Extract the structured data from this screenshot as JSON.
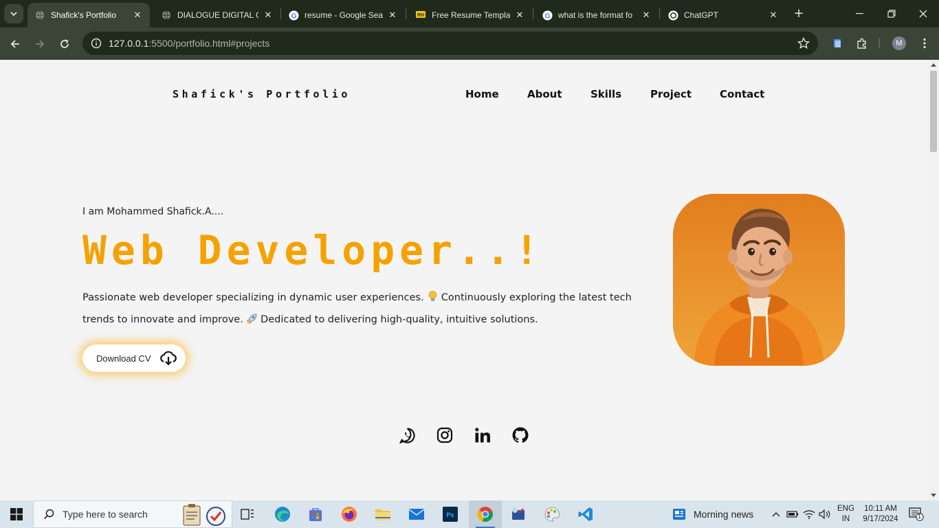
{
  "browser": {
    "tabs": [
      {
        "title": "Shafick's Portfolio",
        "active": true,
        "icon": "globe-icon"
      },
      {
        "title": "DIALOGUE DIGITAL G",
        "active": false,
        "icon": "globe-icon"
      },
      {
        "title": "resume - Google Sear",
        "active": false,
        "icon": "google-icon"
      },
      {
        "title": "Free Resume Templat",
        "active": false,
        "icon": "resume-site-icon"
      },
      {
        "title": "what is the format fo",
        "active": false,
        "icon": "google-icon"
      },
      {
        "title": "ChatGPT",
        "active": false,
        "icon": "chatgpt-icon"
      }
    ],
    "url_host": "127.0.0.1",
    "url_path": ":5500/portfolio.html#projects",
    "profile_initial": "M"
  },
  "site": {
    "logo": "Shafick's Portfolio",
    "nav": [
      "Home",
      "About",
      "Skills",
      "Project",
      "Contact"
    ],
    "intro": "I am Mohammed Shafick.A....",
    "headline": "Web Developer..!",
    "desc_part1": "Passionate web developer specializing in dynamic user experiences.",
    "desc_part2": "Continuously exploring the latest tech trends to innovate and improve.",
    "desc_part3": "Dedicated to delivering high-quality, intuitive solutions.",
    "cv_label": "Download CV",
    "social": [
      "whatsapp-icon",
      "instagram-icon",
      "linkedin-icon",
      "github-icon"
    ],
    "accent_color": "#f5a200"
  },
  "taskbar": {
    "search_placeholder": "Type here to search",
    "news": "Morning news",
    "lang_top": "ENG",
    "lang_bottom": "IN",
    "time": "10:11 AM",
    "date": "9/17/2024",
    "notifications": "1"
  }
}
